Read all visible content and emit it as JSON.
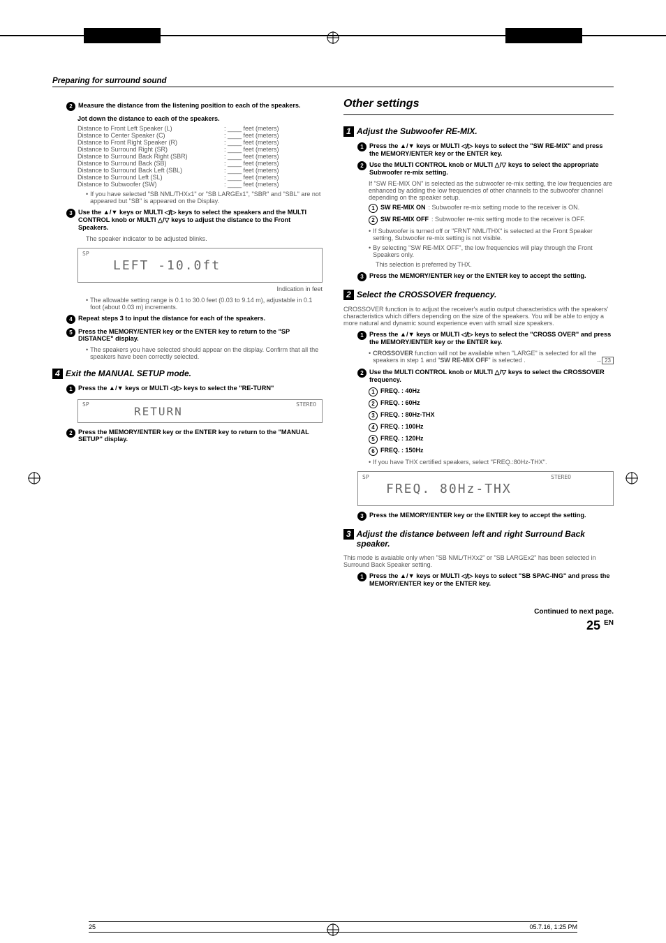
{
  "header": {
    "title": "Preparing for surround sound"
  },
  "left": {
    "s1": {
      "num": "2",
      "title": "Measure the distance from the listening position to each of the speakers.",
      "jot": "Jot down the distance to each of the speakers.",
      "rows": [
        {
          "label": "Distance to Front Left Speaker (L)",
          "unit": "feet (meters)"
        },
        {
          "label": "Distance to Center Speaker (C)",
          "unit": "feet (meters)"
        },
        {
          "label": "Distance to Front Right Speaker (R)",
          "unit": "feet (meters)"
        },
        {
          "label": "Distance to Surround Right (SR)",
          "unit": "feet (meters)"
        },
        {
          "label": "Distance to Surround Back Right (SBR)",
          "unit": "feet (meters)"
        },
        {
          "label": "Distance to Surround Back (SB)",
          "unit": "feet (meters)"
        },
        {
          "label": "Distance to Surround Back Left (SBL)",
          "unit": "feet (meters)"
        },
        {
          "label": "Distance to Surround Left (SL)",
          "unit": "feet (meters)"
        },
        {
          "label": "Distance to Subwoofer (SW)",
          "unit": "feet (meters)"
        }
      ],
      "bullet1": "If you have selected \"SB NML/THXx1\" or \"SB LARGEx1\", \"SBR\" and \"SBL\" are not appeared but \"SB\" is appeared on the Display."
    },
    "s2": {
      "num": "3",
      "title": "Use the ▲/▼ keys or MULTI ◁/▷ keys to select the speakers and the MULTI CONTROL knob or MULTI △/▽ keys to adjust the distance to the Front Speakers.",
      "note": "The speaker indicator to be adjusted blinks.",
      "display": "LEFT   -10.0ft",
      "caption": "Indication in feet",
      "bullet": "The allowable setting range is 0.1 to 30.0 feet (0.03 to 9.14 m), adjustable in 0.1 foot (about 0.03 m) increments."
    },
    "s3": {
      "num": "4",
      "title": "Repeat steps 3 to input the distance for each of the speakers."
    },
    "s4": {
      "num": "5",
      "title": "Press the MEMORY/ENTER key or the ENTER key to return to the \"SP DISTANCE\" display.",
      "bullet": "The speakers you have selected should appear on the display. Confirm that all the speakers have been correctly selected."
    },
    "exit": {
      "box": "4",
      "title": "Exit the MANUAL SETUP mode.",
      "s1": {
        "num": "1",
        "title": "Press the ▲/▼ keys or MULTI ◁/▷ keys to select the \"RE-TURN\"",
        "display": "RETURN"
      },
      "s2": {
        "num": "2",
        "title": "Press the MEMORY/ENTER key or the ENTER key to return to the \"MANUAL SETUP\" display."
      }
    }
  },
  "right": {
    "title": "Other settings",
    "step1": {
      "box": "1",
      "title": "Adjust the Subwoofer RE-MIX.",
      "s1": {
        "num": "1",
        "title": "Press the ▲/▼ keys or MULTI ◁/▷ keys to select the \"SW RE-MIX\" and press the MEMORY/ENTER key or the ENTER key."
      },
      "s2": {
        "num": "2",
        "title": "Use the MULTI CONTROL knob or MULTI △/▽ keys to select the appropriate Subwoofer re-mix setting.",
        "note": "If \"SW RE-MIX ON\" is selected as the subwoofer re-mix setting, the low frequencies are enhanced by adding the low frequencies of other channels to the subwoofer channel depending on the speaker setup."
      },
      "d1": {
        "num": "①",
        "term": "SW RE-MIX ON",
        "def": ": Subwoofer re-mix setting mode to the receiver is ON."
      },
      "d2": {
        "num": "②",
        "term": "SW RE-MIX OFF",
        "def": ": Subwoofer re-mix setting mode to the receiver is OFF."
      },
      "b1": "If Subwoofer is turned off or \"FRNT NML/THX\" is selected at the Front Speaker setting, Subwoofer re-mix setting is not visible.",
      "b2": "By selecting \"SW RE-MIX OFF\", the low frequencies will play through the Front Speakers only.",
      "b2a": "This selection is preferred by THX.",
      "s3": {
        "num": "3",
        "title": "Press the MEMORY/ENTER key or the ENTER key to accept the setting."
      }
    },
    "step2": {
      "box": "2",
      "title": "Select the CROSSOVER frequency.",
      "intro": "CROSSOVER function is to adjust the receiver's audio output characteristics with the speakers' characteristics which differs depending on the size of the speakers. You will be able to enjoy a more natural and dynamic sound experience even with small size speakers.",
      "s1": {
        "num": "1",
        "title": "Press the ▲/▼ keys or MULTI ◁/▷ keys to select the \"CROSS OVER\" and press the MEMORY/ENTER key or the ENTER key."
      },
      "b1a": "CROSSOVER",
      "b1b": " function will not be available when \"LARGE\" is selected for all the speakers in step 1 and \"",
      "b1c": "SW RE-MIX OFF",
      "b1d": "\" is selected .",
      "page": "23",
      "s2": {
        "num": "2",
        "title": "Use the MULTI CONTROL knob or MULTI △/▽ keys to select the CROSSOVER frequency."
      },
      "opts": [
        "FREQ. : 40Hz",
        "FREQ. : 60Hz",
        "FREQ. : 80Hz-THX",
        "FREQ. : 100Hz",
        "FREQ. : 120Hz",
        "FREQ. : 150Hz"
      ],
      "b2": "If you have THX certified speakers, select \"FREQ.:80Hz-THX\".",
      "display": "FREQ.  80Hz-THX",
      "s3": {
        "num": "3",
        "title": "Press the MEMORY/ENTER key or the ENTER key to accept the setting."
      }
    },
    "step3": {
      "box": "3",
      "title": "Adjust the distance between left and right Surround Back speaker.",
      "intro": "This mode is avaiable only when \"SB NML/THXx2\" or \"SB LARGEx2\" has been selected in Surround Back Speaker setting.",
      "s1": {
        "num": "1",
        "title": "Press the ▲/▼ keys or MULTI ◁/▷ keys to select \"SB SPAC-ING\" and press the MEMORY/ENTER key or the ENTER key."
      }
    }
  },
  "continued": "Continued to next page.",
  "pagenum": "25",
  "pagesup": "EN",
  "footer": {
    "left": "25",
    "right": "05.7.16, 1:25 PM"
  }
}
